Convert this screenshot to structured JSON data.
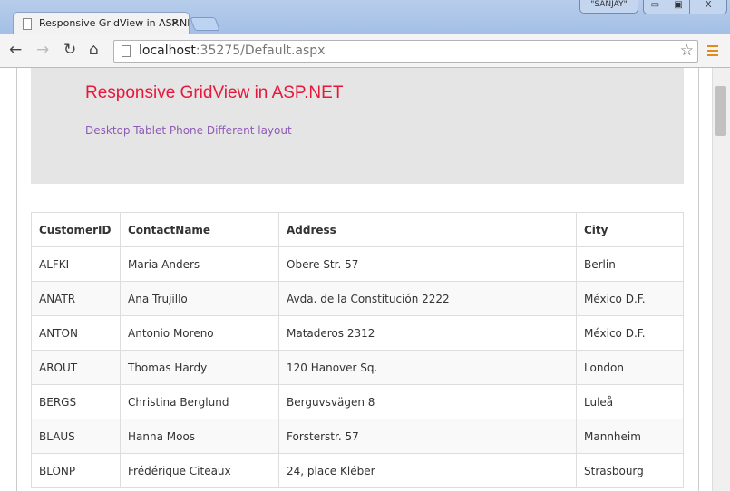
{
  "browser": {
    "tab_title": "Responsive GridView in ASP.NET",
    "user": "\"SANJAY\"",
    "url_host": "localhost",
    "url_path": ":35275/Default.aspx"
  },
  "page": {
    "title": "Responsive GridView in ASP.NET",
    "subtitle": "Desktop Tablet Phone Different layout"
  },
  "grid": {
    "headers": [
      "CustomerID",
      "ContactName",
      "Address",
      "City"
    ],
    "rows": [
      [
        "ALFKI",
        "Maria Anders",
        "Obere Str. 57",
        "Berlin"
      ],
      [
        "ANATR",
        "Ana Trujillo",
        "Avda. de la Constitución 2222",
        "México D.F."
      ],
      [
        "ANTON",
        "Antonio Moreno",
        "Mataderos 2312",
        "México D.F."
      ],
      [
        "AROUT",
        "Thomas Hardy",
        "120 Hanover Sq.",
        "London"
      ],
      [
        "BERGS",
        "Christina Berglund",
        "Berguvsvägen 8",
        "Luleå"
      ],
      [
        "BLAUS",
        "Hanna Moos",
        "Forsterstr. 57",
        "Mannheim"
      ],
      [
        "BLONP",
        "Frédérique Citeaux",
        "24, place Kléber",
        "Strasbourg"
      ]
    ]
  }
}
